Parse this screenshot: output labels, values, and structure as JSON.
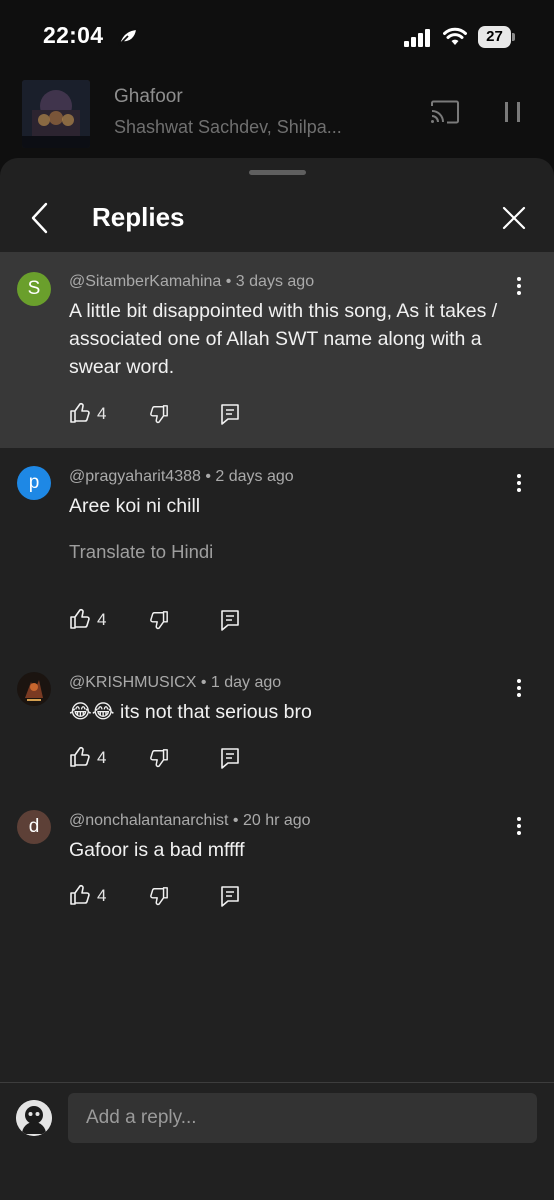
{
  "status": {
    "time": "22:04",
    "battery": "27",
    "icons": [
      "leaf-icon",
      "signal-icon",
      "wifi-icon",
      "battery-icon"
    ]
  },
  "player": {
    "title": "Ghafoor",
    "artist": "Shashwat Sachdev, Shilpa...",
    "icons": [
      "cast-icon",
      "pause-icon"
    ]
  },
  "sheet": {
    "title": "Replies"
  },
  "comments": [
    {
      "avatar_letter": "S",
      "avatar_color": "#6a9f2c",
      "meta": "@SitamberKamahina • 3 days ago",
      "text": "A little bit disappointed with this song, As it takes / associated one of Allah SWT name along with a swear word.",
      "likes": "4"
    },
    {
      "avatar_letter": "p",
      "avatar_color": "#1e88e5",
      "meta": "@pragyaharit4388 • 2 days ago",
      "text": "Aree koi ni chill",
      "translate": "Translate to Hindi",
      "likes": "4"
    },
    {
      "avatar_letter": "",
      "meta": "@KRISHMUSICX • 1 day ago",
      "text": "😂😂 its not that serious bro",
      "likes": "4"
    },
    {
      "avatar_letter": "d",
      "avatar_color": "#5d4037",
      "meta": "@nonchalantanarchist • 20 hr ago",
      "text": "Gafoor is a bad mffff",
      "likes": "4"
    }
  ],
  "reply_box": {
    "placeholder": "Add a reply..."
  }
}
